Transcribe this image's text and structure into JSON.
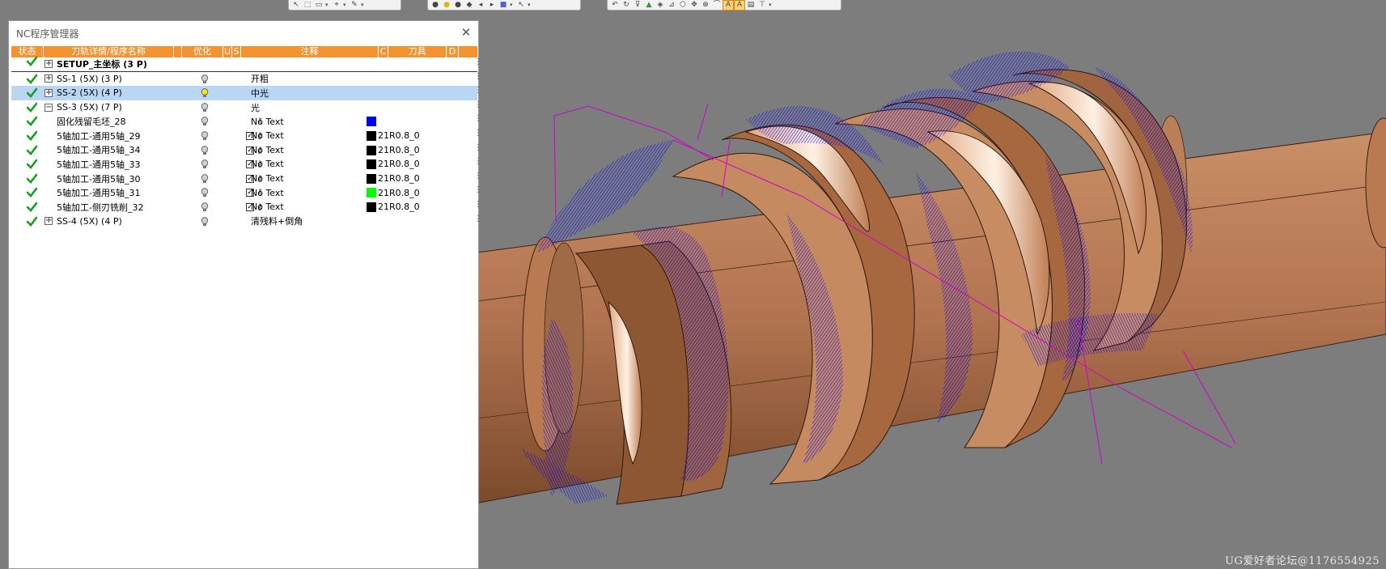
{
  "panel": {
    "title": "NC程序管理器",
    "columns": {
      "status": "状态",
      "name": "刀轨详情/程序名称",
      "opt": "优化",
      "u": "U",
      "s": "S",
      "note": "注释",
      "c": "C",
      "tool": "刀具",
      "d": "D"
    },
    "rows": [
      {
        "name": "SETUP_主坐标 (3 P)",
        "note": "",
        "tool": "",
        "bold": true,
        "expander": "+"
      },
      {
        "name": "SS-1 (5X) (3 P)",
        "note": "开粗",
        "tool": "",
        "expander": "+"
      },
      {
        "name": "SS-2 (5X) (4 P)",
        "note": "中光",
        "tool": "",
        "expander": "+",
        "selected": true
      },
      {
        "name": "SS-3 (5X) (7 P)",
        "note": "光",
        "tool": "",
        "expander": "−"
      },
      {
        "name": "固化残留毛坯_28",
        "note": "No Text",
        "tool": "",
        "swatch": "#0000ff"
      },
      {
        "name": "5轴加工-通用5轴_29",
        "note": "No Text",
        "tool": "21R0.8_0",
        "swatch": "#000000"
      },
      {
        "name": "5轴加工-通用5轴_34",
        "note": "No Text",
        "tool": "21R0.8_0",
        "swatch": "#000000"
      },
      {
        "name": "5轴加工-通用5轴_33",
        "note": "No Text",
        "tool": "21R0.8_0",
        "swatch": "#000000"
      },
      {
        "name": "5轴加工-通用5轴_30",
        "note": "No Text",
        "tool": "21R0.8_0",
        "swatch": "#000000"
      },
      {
        "name": "5轴加工-通用5轴_31",
        "note": "No Text",
        "tool": "21R0.8_0",
        "swatch": "#00ff00"
      },
      {
        "name": "5轴加工-侧刃铣削_32",
        "note": "No Text",
        "tool": "21R0.8_0",
        "swatch": "#000000"
      },
      {
        "name": "SS-4 (5X) (4 P)",
        "note": "清残料+倒角",
        "tool": "",
        "expander": "+"
      }
    ]
  },
  "watermark": "UG爱好者论坛@1176554925",
  "colors": {
    "header_orange": "#f59331",
    "selection_blue": "#b9d7f5",
    "toolpath_blue": "#0000ff",
    "toolpath_magenta": "#d000d0",
    "part_copper": "#b87a4e",
    "viewport_gray": "#7d7d7d"
  }
}
